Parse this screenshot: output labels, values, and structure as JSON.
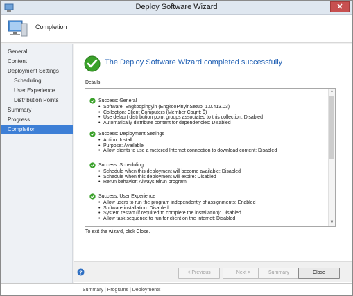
{
  "window": {
    "title": "Deploy Software Wizard",
    "close_glyph": "✕"
  },
  "header": {
    "title": "Completion",
    "icon": "computer-icon"
  },
  "sidebar": {
    "items": [
      {
        "label": "General",
        "sub": false,
        "active": false
      },
      {
        "label": "Content",
        "sub": false,
        "active": false
      },
      {
        "label": "Deployment Settings",
        "sub": false,
        "active": false
      },
      {
        "label": "Scheduling",
        "sub": true,
        "active": false
      },
      {
        "label": "User Experience",
        "sub": true,
        "active": false
      },
      {
        "label": "Distribution Points",
        "sub": true,
        "active": false
      },
      {
        "label": "Summary",
        "sub": false,
        "active": false
      },
      {
        "label": "Progress",
        "sub": false,
        "active": false
      },
      {
        "label": "Completion",
        "sub": false,
        "active": true
      }
    ]
  },
  "main": {
    "success_title": "The Deploy Software Wizard completed successfully",
    "details_label": "Details:",
    "sections": [
      {
        "title": "Success: General",
        "items": [
          "Software: Engkoopingyin (EngkooPinyinSetup_1.0.413.03)",
          "Collection: Client Computers (Member Count: 9)",
          "Use default distribution point groups associated to this collection: Disabled",
          "Automatically distribute content for dependencies: Disabled"
        ]
      },
      {
        "title": "Success: Deployment Settings",
        "items": [
          "Action: Install",
          "Purpose: Available",
          "Allow clients to use a metered Internet connection to download content: Disabled"
        ]
      },
      {
        "title": "Success: Scheduling",
        "items": [
          "Schedule when this deployment will become available: Disabled",
          "Schedule when this deployment will expire: Disabled",
          "Rerun behavior: Always rerun program"
        ]
      },
      {
        "title": "Success: User Experience",
        "items": [
          "Allow users to run the program independently of assignments: Enabled",
          "Software installation: Disabled",
          "System restart (if required to complete the installation): Disabled",
          "Allow task sequence to run for client on the Internet: Disabled"
        ]
      }
    ],
    "exit_text": "To exit the wizard, click Close."
  },
  "footer": {
    "previous_label": "< Previous",
    "next_label": "Next >",
    "summary_label": "Summary",
    "close_label": "Close"
  },
  "status_strip": {
    "tabs_text": "Summary | Programs | Deployments"
  },
  "colors": {
    "accent": "#3d7fd6",
    "success_title": "#1f5fb3",
    "success_green": "#3aa12a",
    "close_red": "#c75050"
  }
}
